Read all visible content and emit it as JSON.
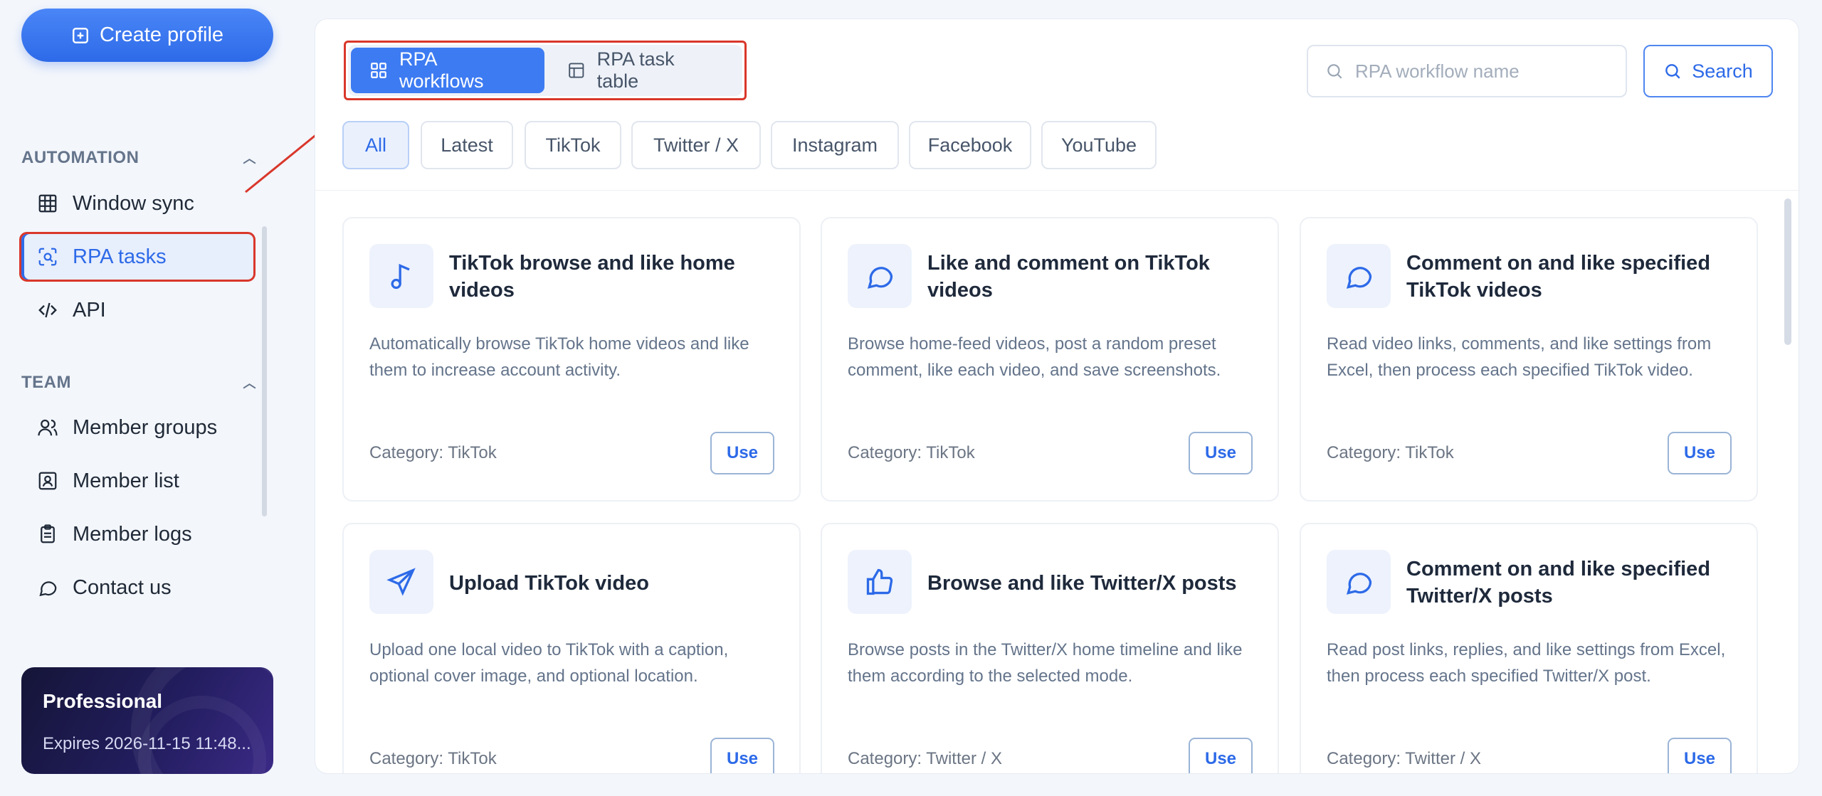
{
  "sidebar": {
    "create_button": "Create profile",
    "sections": [
      {
        "title": "AUTOMATION",
        "items": [
          {
            "label": "Window sync",
            "icon": "grid-icon"
          },
          {
            "label": "RPA tasks",
            "icon": "scan-robot-icon",
            "active": true
          },
          {
            "label": "API",
            "icon": "code-icon"
          }
        ]
      },
      {
        "title": "TEAM",
        "items": [
          {
            "label": "Member groups",
            "icon": "users-icon"
          },
          {
            "label": "Member list",
            "icon": "id-badge-icon"
          },
          {
            "label": "Member logs",
            "icon": "clipboard-icon"
          },
          {
            "label": "Contact us",
            "icon": "chat-icon"
          }
        ]
      }
    ],
    "plan": {
      "name": "Professional",
      "expires": "Expires 2026-11-15 11:48..."
    }
  },
  "main": {
    "tabs": [
      {
        "label": "RPA workflows",
        "active": true
      },
      {
        "label": "RPA task table",
        "active": false
      }
    ],
    "search": {
      "placeholder": "RPA workflow name",
      "value": "",
      "button": "Search"
    },
    "filters": [
      {
        "label": "All",
        "active": true
      },
      {
        "label": "Latest"
      },
      {
        "label": "TikTok"
      },
      {
        "label": "Twitter / X"
      },
      {
        "label": "Instagram"
      },
      {
        "label": "Facebook"
      },
      {
        "label": "YouTube"
      }
    ],
    "cards": [
      {
        "title": "TikTok browse and like home videos",
        "description": "Automatically browse TikTok home videos and like them to increase account activity.",
        "category": "Category: TikTok",
        "icon": "music-note-icon",
        "button": "Use"
      },
      {
        "title": "Like and comment on TikTok videos",
        "description": "Browse home-feed videos, post a random preset comment, like each video, and save screenshots.",
        "category": "Category: TikTok",
        "icon": "comment-bubble-icon",
        "button": "Use"
      },
      {
        "title": "Comment on and like specified TikTok videos",
        "description": "Read video links, comments, and like settings from Excel, then process each specified TikTok video.",
        "category": "Category: TikTok",
        "icon": "comment-bubble-icon",
        "button": "Use"
      },
      {
        "title": "Upload TikTok video",
        "description": "Upload one local video to TikTok with a caption, optional cover image, and optional location.",
        "category": "Category: TikTok",
        "icon": "send-icon",
        "button": "Use"
      },
      {
        "title": "Browse and like Twitter/X posts",
        "description": "Browse posts in the Twitter/X home timeline and like them according to the selected mode.",
        "category": "Category: Twitter / X",
        "icon": "thumbs-up-icon",
        "button": "Use"
      },
      {
        "title": "Comment on and like specified Twitter/X posts",
        "description": "Read post links, replies, and like settings from Excel, then process each specified Twitter/X post.",
        "category": "Category: Twitter / X",
        "icon": "comment-bubble-icon",
        "button": "Use"
      }
    ]
  },
  "colors": {
    "accent": "#2d6ae8",
    "annotation": "#d9372b",
    "plan_card": "#221d5e"
  }
}
